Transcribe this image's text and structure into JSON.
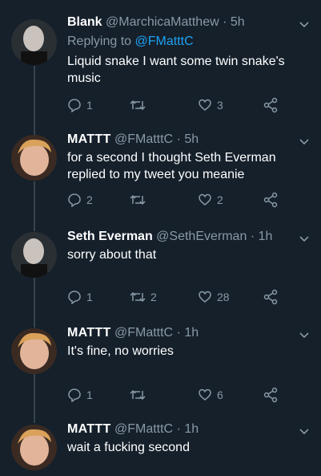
{
  "tweets": [
    {
      "name": "Blank",
      "handle": "@MarchicaMatthew",
      "time": "· 5h",
      "replying_label": "Replying to",
      "replying_handle": "@FMatttC",
      "text": "Liquid snake I want some twin snake's music",
      "replies": "1",
      "retweets": "",
      "likes": "3"
    },
    {
      "name": "MATTT",
      "handle": "@FMatttC",
      "time": "· 5h",
      "text": "for a second I thought Seth Everman replied to my tweet you meanie",
      "replies": "2",
      "retweets": "",
      "likes": "2"
    },
    {
      "name": "Seth Everman",
      "handle": "@SethEverman",
      "time": "· 1h",
      "text": "sorry about that",
      "replies": "1",
      "retweets": "2",
      "likes": "28"
    },
    {
      "name": "MATTT",
      "handle": "@FMatttC",
      "time": "· 1h",
      "text": "It's fine, no worries",
      "replies": "1",
      "retweets": "",
      "likes": "6"
    },
    {
      "name": "MATTT",
      "handle": "@FMatttC",
      "time": "· 1h",
      "text": "wait a fucking second"
    }
  ],
  "colors": {
    "background": "#15202b",
    "muted": "#8899a6",
    "link": "#1da1f2",
    "thread_line": "#38444d"
  },
  "icons": [
    "reply-icon",
    "retweet-icon",
    "like-icon",
    "share-icon",
    "chevron-down-icon"
  ]
}
